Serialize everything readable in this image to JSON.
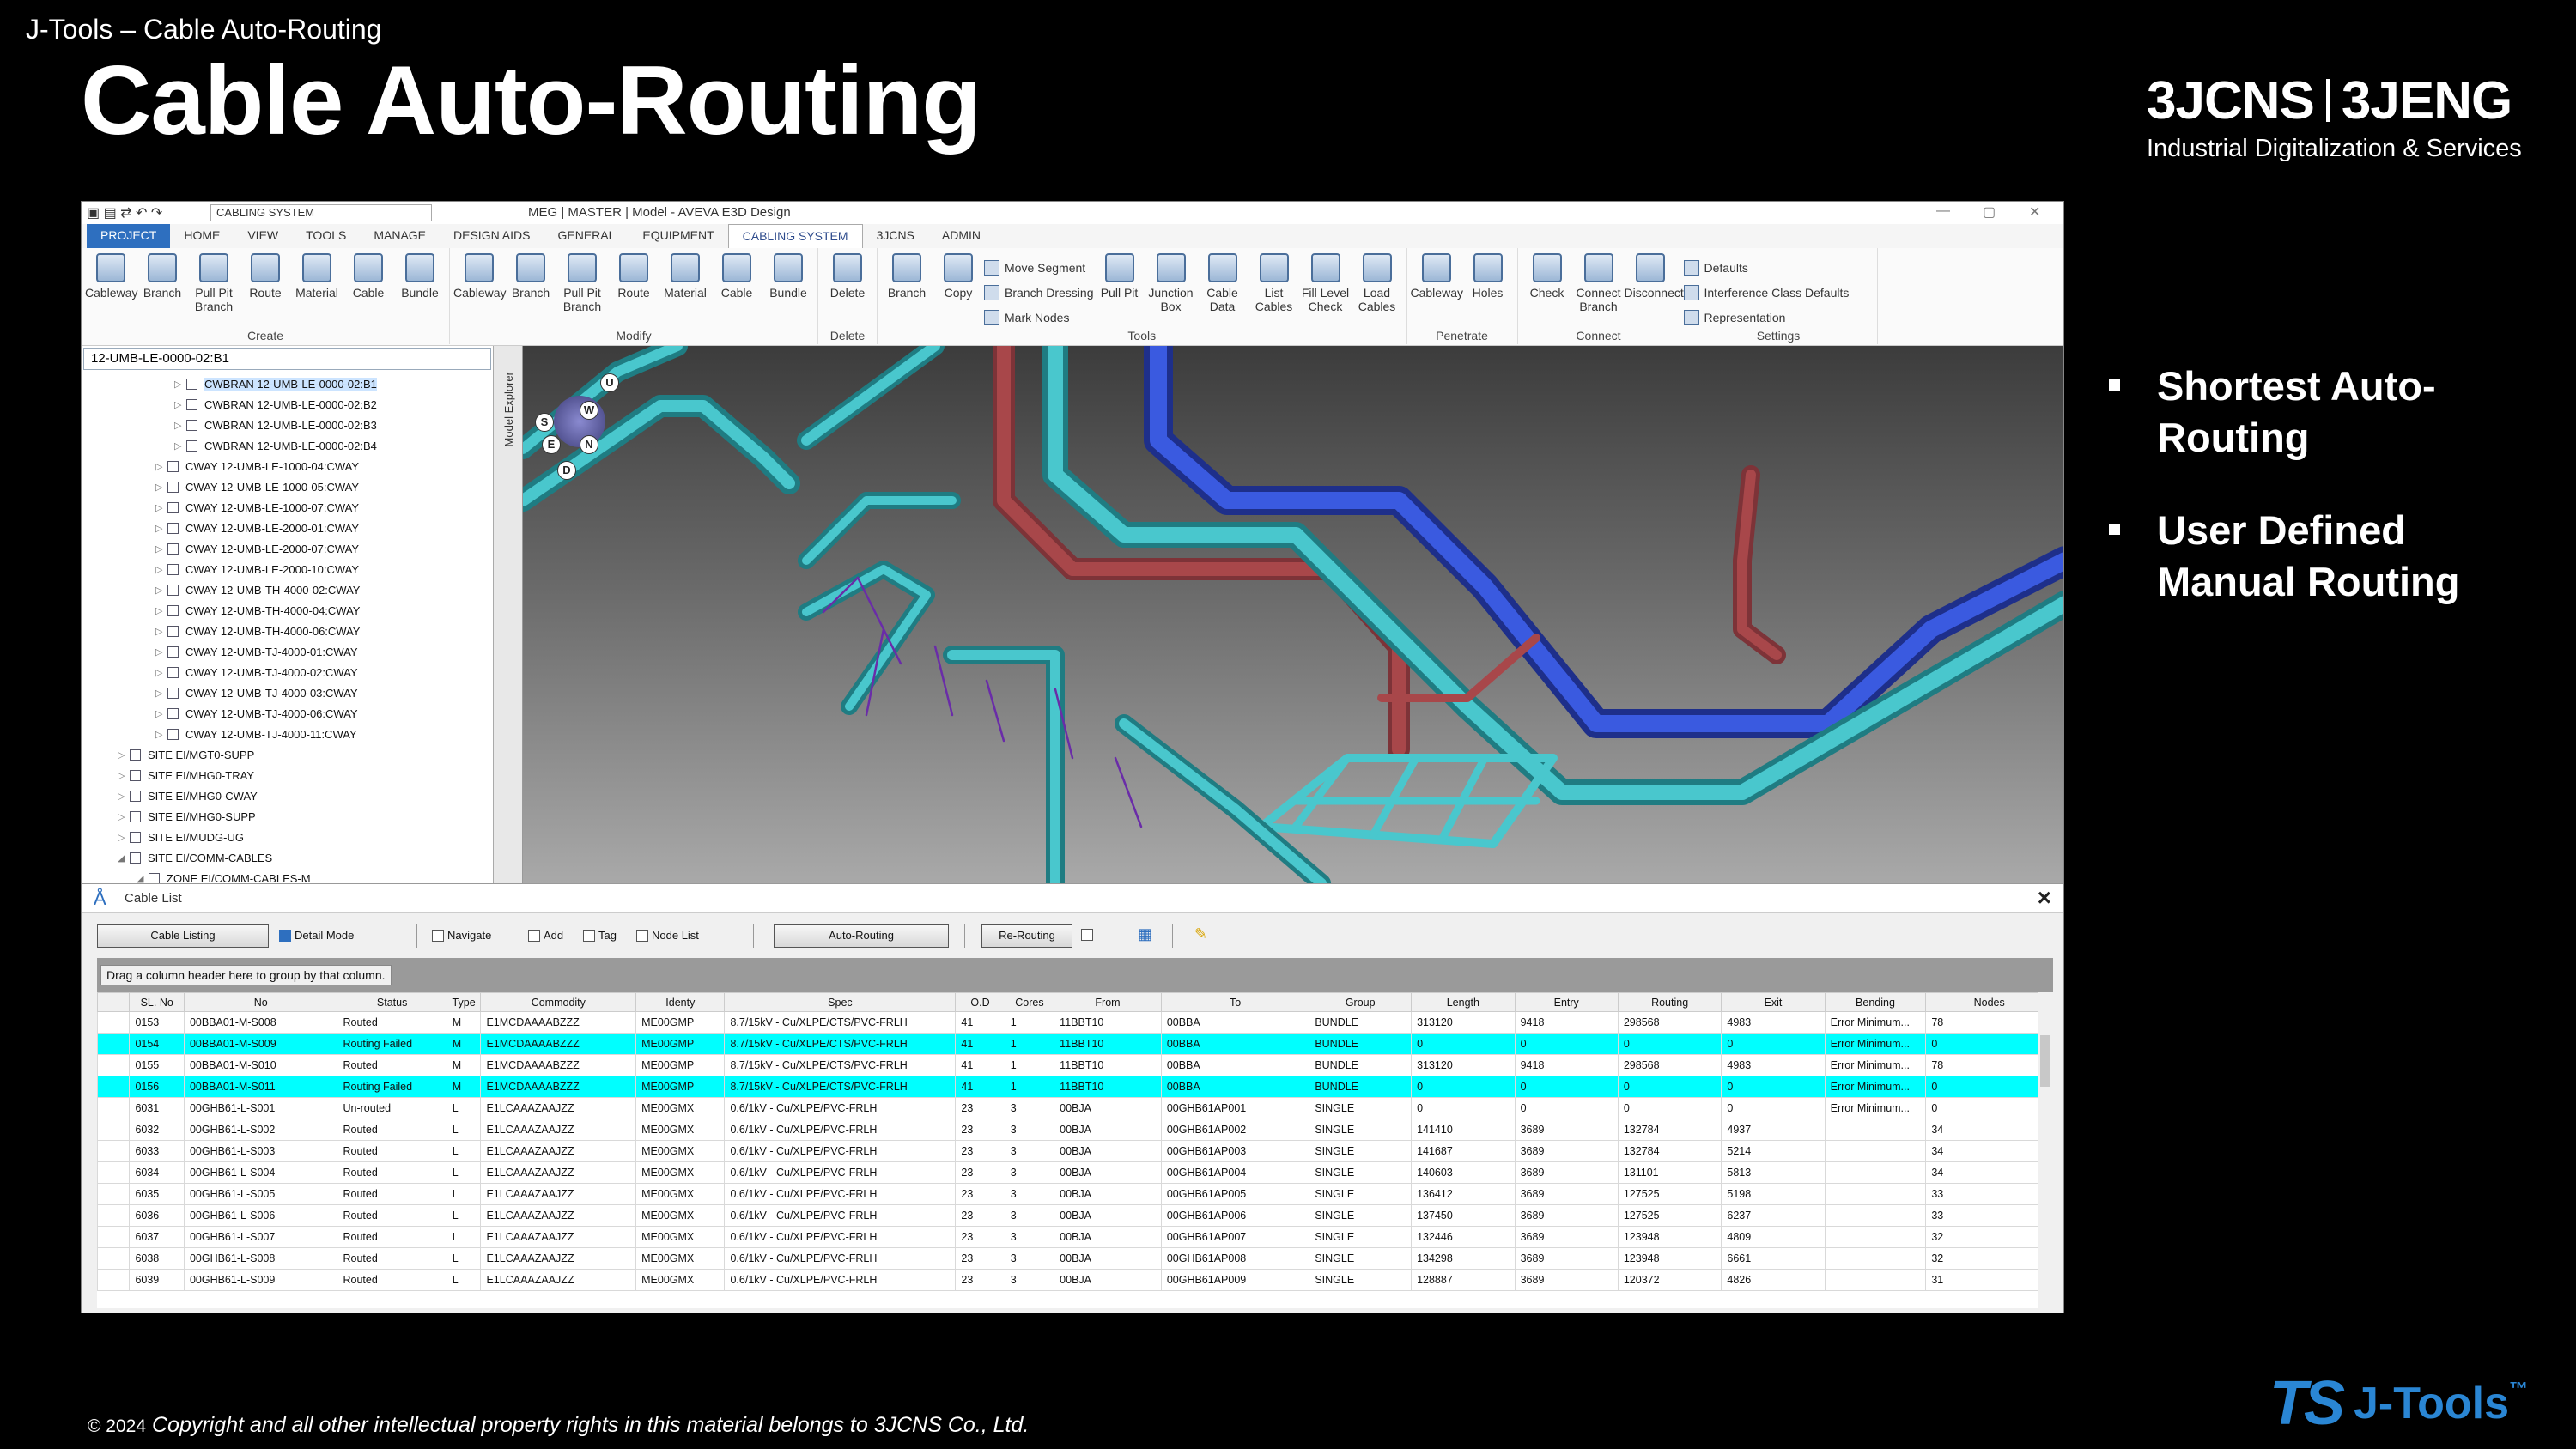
{
  "slide": {
    "breadcrumb": "J-Tools – Cable Auto-Routing",
    "title": "Cable Auto-Routing",
    "logo_left": "3JCNS",
    "logo_right": "3JENG",
    "logo_subtitle": "Industrial Digitalization & Services",
    "bullets": [
      "Shortest Auto-Routing",
      "User Defined Manual Routing"
    ],
    "copyright_year": "© 2024",
    "copyright_text": "Copyright and all other intellectual property rights in this material belongs to 3JCNS Co., Ltd.",
    "brand_mark": "TS",
    "brand_name": "J-Tools",
    "brand_tm": "™"
  },
  "app": {
    "workspace": "CABLING SYSTEM",
    "window_title": "MEG | MASTER | Model - AVEVA E3D Design",
    "menu_tabs": [
      "PROJECT",
      "HOME",
      "VIEW",
      "TOOLS",
      "MANAGE",
      "DESIGN AIDS",
      "GENERAL",
      "EQUIPMENT",
      "CABLING SYSTEM",
      "3JCNS",
      "ADMIN"
    ],
    "active_tab_index": 8,
    "ribbon": {
      "create": {
        "label": "Create",
        "buttons": [
          "Cableway",
          "Branch",
          "Pull Pit Branch",
          "Route",
          "Material",
          "Cable",
          "Bundle"
        ]
      },
      "modify": {
        "label": "Modify",
        "buttons": [
          "Cableway",
          "Branch",
          "Pull Pit Branch",
          "Route",
          "Material",
          "Cable",
          "Bundle"
        ]
      },
      "delete": {
        "label": "Delete",
        "buttons": [
          "Delete"
        ]
      },
      "tools": {
        "label": "Tools",
        "buttons": [
          "Branch",
          "Copy"
        ],
        "small": [
          "Move Segment",
          "Branch Dressing",
          "Mark Nodes"
        ],
        "buttons2": [
          "Pull Pit",
          "Junction Box",
          "Cable Data",
          "List Cables",
          "Fill Level Check",
          "Load Cables"
        ]
      },
      "penetrate": {
        "label": "Penetrate",
        "buttons": [
          "Cableway",
          "Holes"
        ]
      },
      "connect": {
        "label": "Connect",
        "buttons": [
          "Check",
          "Connect Branch",
          "Disconnect"
        ]
      },
      "settings": {
        "label": "Settings",
        "small": [
          "Defaults",
          "Interference Class Defaults",
          "Representation"
        ]
      }
    }
  },
  "explorer": {
    "current": "12-UMB-LE-0000-02:B1",
    "side_tab": "Model Explorer",
    "items": [
      {
        "text": "CWBRAN 12-UMB-LE-0000-02:B1",
        "indent": 4,
        "sel": true
      },
      {
        "text": "CWBRAN 12-UMB-LE-0000-02:B2",
        "indent": 4
      },
      {
        "text": "CWBRAN 12-UMB-LE-0000-02:B3",
        "indent": 4
      },
      {
        "text": "CWBRAN 12-UMB-LE-0000-02:B4",
        "indent": 4
      },
      {
        "text": "CWAY 12-UMB-LE-1000-04:CWAY",
        "indent": 3
      },
      {
        "text": "CWAY 12-UMB-LE-1000-05:CWAY",
        "indent": 3
      },
      {
        "text": "CWAY 12-UMB-LE-1000-07:CWAY",
        "indent": 3
      },
      {
        "text": "CWAY 12-UMB-LE-2000-01:CWAY",
        "indent": 3
      },
      {
        "text": "CWAY 12-UMB-LE-2000-07:CWAY",
        "indent": 3
      },
      {
        "text": "CWAY 12-UMB-LE-2000-10:CWAY",
        "indent": 3
      },
      {
        "text": "CWAY 12-UMB-TH-4000-02:CWAY",
        "indent": 3
      },
      {
        "text": "CWAY 12-UMB-TH-4000-04:CWAY",
        "indent": 3
      },
      {
        "text": "CWAY 12-UMB-TH-4000-06:CWAY",
        "indent": 3
      },
      {
        "text": "CWAY 12-UMB-TJ-4000-01:CWAY",
        "indent": 3
      },
      {
        "text": "CWAY 12-UMB-TJ-4000-02:CWAY",
        "indent": 3
      },
      {
        "text": "CWAY 12-UMB-TJ-4000-03:CWAY",
        "indent": 3
      },
      {
        "text": "CWAY 12-UMB-TJ-4000-06:CWAY",
        "indent": 3
      },
      {
        "text": "CWAY 12-UMB-TJ-4000-11:CWAY",
        "indent": 3
      },
      {
        "text": "SITE EI/MGT0-SUPP",
        "indent": 1
      },
      {
        "text": "SITE EI/MHG0-TRAY",
        "indent": 1
      },
      {
        "text": "SITE EI/MHG0-CWAY",
        "indent": 1
      },
      {
        "text": "SITE EI/MHG0-SUPP",
        "indent": 1
      },
      {
        "text": "SITE EI/MUDG-UG",
        "indent": 1
      },
      {
        "text": "SITE EI/COMM-CABLES",
        "indent": 1
      },
      {
        "text": "ZONE EI/COMM-CABLES-M",
        "indent": 2
      }
    ]
  },
  "compass": [
    "U",
    "W",
    "S",
    "N",
    "E",
    "D"
  ],
  "cable_list": {
    "title": "Cable List",
    "btn_listing": "Cable Listing",
    "chk_detail": "Detail Mode",
    "chk_navigate": "Navigate",
    "chk_add": "Add",
    "chk_tag": "Tag",
    "chk_nodelist": "Node List",
    "btn_autorouting": "Auto-Routing",
    "btn_rerouting": "Re-Routing",
    "group_hint": "Drag a column header here to group by that column.",
    "columns": [
      "SL. No",
      "No",
      "Status",
      "Type",
      "Commodity",
      "Identy",
      "Spec",
      "O.D",
      "Cores",
      "From",
      "To",
      "Group",
      "Length",
      "Entry",
      "Routing",
      "Exit",
      "Bending",
      "Nodes"
    ],
    "rows": [
      {
        "c": [
          "0153",
          "00BBA01-M-S008",
          "Routed",
          "M",
          "E1MCDAAAABZZZ",
          "ME00GMP",
          "8.7/15kV - Cu/XLPE/CTS/PVC-FRLH",
          "41",
          "1",
          "11BBT10",
          "00BBA",
          "BUNDLE",
          "313120",
          "9418",
          "298568",
          "4983",
          "Error Minimum...",
          "78"
        ],
        "hl": false
      },
      {
        "c": [
          "0154",
          "00BBA01-M-S009",
          "Routing Failed",
          "M",
          "E1MCDAAAABZZZ",
          "ME00GMP",
          "8.7/15kV - Cu/XLPE/CTS/PVC-FRLH",
          "41",
          "1",
          "11BBT10",
          "00BBA",
          "BUNDLE",
          "0",
          "0",
          "0",
          "0",
          "Error Minimum...",
          "0"
        ],
        "hl": true
      },
      {
        "c": [
          "0155",
          "00BBA01-M-S010",
          "Routed",
          "M",
          "E1MCDAAAABZZZ",
          "ME00GMP",
          "8.7/15kV - Cu/XLPE/CTS/PVC-FRLH",
          "41",
          "1",
          "11BBT10",
          "00BBA",
          "BUNDLE",
          "313120",
          "9418",
          "298568",
          "4983",
          "Error Minimum...",
          "78"
        ],
        "hl": false
      },
      {
        "c": [
          "0156",
          "00BBA01-M-S011",
          "Routing Failed",
          "M",
          "E1MCDAAAABZZZ",
          "ME00GMP",
          "8.7/15kV - Cu/XLPE/CTS/PVC-FRLH",
          "41",
          "1",
          "11BBT10",
          "00BBA",
          "BUNDLE",
          "0",
          "0",
          "0",
          "0",
          "Error Minimum...",
          "0"
        ],
        "hl": true
      },
      {
        "c": [
          "6031",
          "00GHB61-L-S001",
          "Un-routed",
          "L",
          "E1LCAAAZAAJZZ",
          "ME00GMX",
          "0.6/1kV - Cu/XLPE/PVC-FRLH",
          "23",
          "3",
          "00BJA",
          "00GHB61AP001",
          "SINGLE",
          "0",
          "0",
          "0",
          "0",
          "Error Minimum...",
          "0"
        ],
        "hl": false
      },
      {
        "c": [
          "6032",
          "00GHB61-L-S002",
          "Routed",
          "L",
          "E1LCAAAZAAJZZ",
          "ME00GMX",
          "0.6/1kV - Cu/XLPE/PVC-FRLH",
          "23",
          "3",
          "00BJA",
          "00GHB61AP002",
          "SINGLE",
          "141410",
          "3689",
          "132784",
          "4937",
          "",
          "34"
        ],
        "hl": false
      },
      {
        "c": [
          "6033",
          "00GHB61-L-S003",
          "Routed",
          "L",
          "E1LCAAAZAAJZZ",
          "ME00GMX",
          "0.6/1kV - Cu/XLPE/PVC-FRLH",
          "23",
          "3",
          "00BJA",
          "00GHB61AP003",
          "SINGLE",
          "141687",
          "3689",
          "132784",
          "5214",
          "",
          "34"
        ],
        "hl": false
      },
      {
        "c": [
          "6034",
          "00GHB61-L-S004",
          "Routed",
          "L",
          "E1LCAAAZAAJZZ",
          "ME00GMX",
          "0.6/1kV - Cu/XLPE/PVC-FRLH",
          "23",
          "3",
          "00BJA",
          "00GHB61AP004",
          "SINGLE",
          "140603",
          "3689",
          "131101",
          "5813",
          "",
          "34"
        ],
        "hl": false
      },
      {
        "c": [
          "6035",
          "00GHB61-L-S005",
          "Routed",
          "L",
          "E1LCAAAZAAJZZ",
          "ME00GMX",
          "0.6/1kV - Cu/XLPE/PVC-FRLH",
          "23",
          "3",
          "00BJA",
          "00GHB61AP005",
          "SINGLE",
          "136412",
          "3689",
          "127525",
          "5198",
          "",
          "33"
        ],
        "hl": false
      },
      {
        "c": [
          "6036",
          "00GHB61-L-S006",
          "Routed",
          "L",
          "E1LCAAAZAAJZZ",
          "ME00GMX",
          "0.6/1kV - Cu/XLPE/PVC-FRLH",
          "23",
          "3",
          "00BJA",
          "00GHB61AP006",
          "SINGLE",
          "137450",
          "3689",
          "127525",
          "6237",
          "",
          "33"
        ],
        "hl": false
      },
      {
        "c": [
          "6037",
          "00GHB61-L-S007",
          "Routed",
          "L",
          "E1LCAAAZAAJZZ",
          "ME00GMX",
          "0.6/1kV - Cu/XLPE/PVC-FRLH",
          "23",
          "3",
          "00BJA",
          "00GHB61AP007",
          "SINGLE",
          "132446",
          "3689",
          "123948",
          "4809",
          "",
          "32"
        ],
        "hl": false
      },
      {
        "c": [
          "6038",
          "00GHB61-L-S008",
          "Routed",
          "L",
          "E1LCAAAZAAJZZ",
          "ME00GMX",
          "0.6/1kV - Cu/XLPE/PVC-FRLH",
          "23",
          "3",
          "00BJA",
          "00GHB61AP008",
          "SINGLE",
          "134298",
          "3689",
          "123948",
          "6661",
          "",
          "32"
        ],
        "hl": false
      },
      {
        "c": [
          "6039",
          "00GHB61-L-S009",
          "Routed",
          "L",
          "E1LCAAAZAAJZZ",
          "ME00GMX",
          "0.6/1kV - Cu/XLPE/PVC-FRLH",
          "23",
          "3",
          "00BJA",
          "00GHB61AP009",
          "SINGLE",
          "128887",
          "3689",
          "120372",
          "4826",
          "",
          "31"
        ],
        "hl": false
      }
    ]
  },
  "colors": {
    "highlight_row": "#00ffff",
    "cable_cyan": "#3fbfc6",
    "cable_blue": "#2f4fcf",
    "cable_red": "#a8474a",
    "brand_blue": "#2a86d4"
  }
}
